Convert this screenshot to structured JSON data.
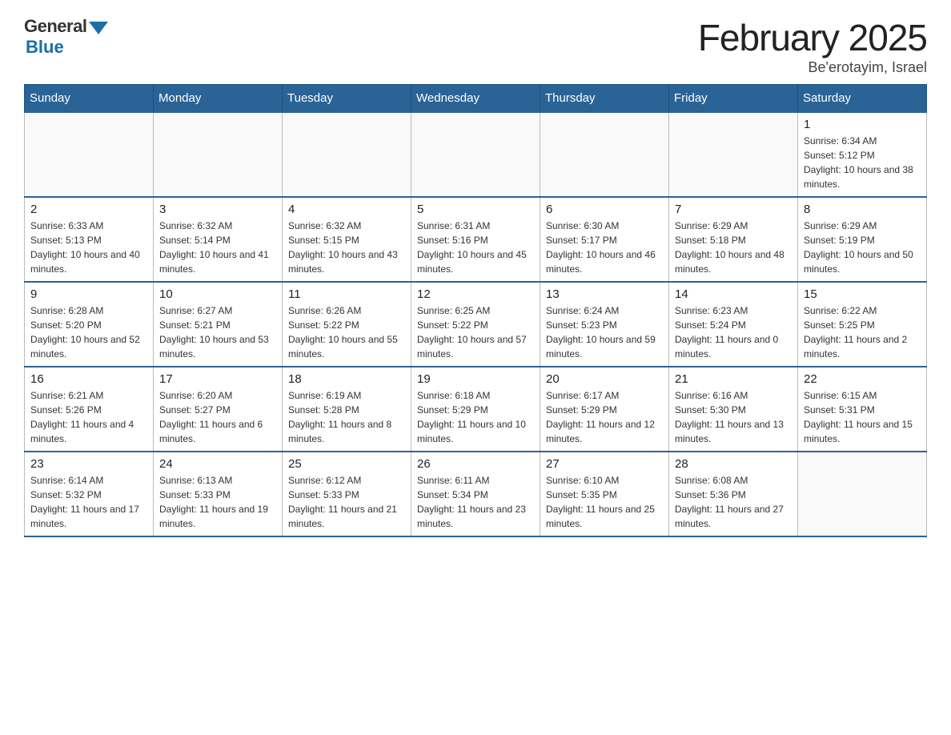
{
  "logo": {
    "general": "General",
    "blue": "Blue"
  },
  "title": "February 2025",
  "subtitle": "Be'erotayim, Israel",
  "days_of_week": [
    "Sunday",
    "Monday",
    "Tuesday",
    "Wednesday",
    "Thursday",
    "Friday",
    "Saturday"
  ],
  "weeks": [
    [
      {
        "day": "",
        "sunrise": "",
        "sunset": "",
        "daylight": ""
      },
      {
        "day": "",
        "sunrise": "",
        "sunset": "",
        "daylight": ""
      },
      {
        "day": "",
        "sunrise": "",
        "sunset": "",
        "daylight": ""
      },
      {
        "day": "",
        "sunrise": "",
        "sunset": "",
        "daylight": ""
      },
      {
        "day": "",
        "sunrise": "",
        "sunset": "",
        "daylight": ""
      },
      {
        "day": "",
        "sunrise": "",
        "sunset": "",
        "daylight": ""
      },
      {
        "day": "1",
        "sunrise": "Sunrise: 6:34 AM",
        "sunset": "Sunset: 5:12 PM",
        "daylight": "Daylight: 10 hours and 38 minutes."
      }
    ],
    [
      {
        "day": "2",
        "sunrise": "Sunrise: 6:33 AM",
        "sunset": "Sunset: 5:13 PM",
        "daylight": "Daylight: 10 hours and 40 minutes."
      },
      {
        "day": "3",
        "sunrise": "Sunrise: 6:32 AM",
        "sunset": "Sunset: 5:14 PM",
        "daylight": "Daylight: 10 hours and 41 minutes."
      },
      {
        "day": "4",
        "sunrise": "Sunrise: 6:32 AM",
        "sunset": "Sunset: 5:15 PM",
        "daylight": "Daylight: 10 hours and 43 minutes."
      },
      {
        "day": "5",
        "sunrise": "Sunrise: 6:31 AM",
        "sunset": "Sunset: 5:16 PM",
        "daylight": "Daylight: 10 hours and 45 minutes."
      },
      {
        "day": "6",
        "sunrise": "Sunrise: 6:30 AM",
        "sunset": "Sunset: 5:17 PM",
        "daylight": "Daylight: 10 hours and 46 minutes."
      },
      {
        "day": "7",
        "sunrise": "Sunrise: 6:29 AM",
        "sunset": "Sunset: 5:18 PM",
        "daylight": "Daylight: 10 hours and 48 minutes."
      },
      {
        "day": "8",
        "sunrise": "Sunrise: 6:29 AM",
        "sunset": "Sunset: 5:19 PM",
        "daylight": "Daylight: 10 hours and 50 minutes."
      }
    ],
    [
      {
        "day": "9",
        "sunrise": "Sunrise: 6:28 AM",
        "sunset": "Sunset: 5:20 PM",
        "daylight": "Daylight: 10 hours and 52 minutes."
      },
      {
        "day": "10",
        "sunrise": "Sunrise: 6:27 AM",
        "sunset": "Sunset: 5:21 PM",
        "daylight": "Daylight: 10 hours and 53 minutes."
      },
      {
        "day": "11",
        "sunrise": "Sunrise: 6:26 AM",
        "sunset": "Sunset: 5:22 PM",
        "daylight": "Daylight: 10 hours and 55 minutes."
      },
      {
        "day": "12",
        "sunrise": "Sunrise: 6:25 AM",
        "sunset": "Sunset: 5:22 PM",
        "daylight": "Daylight: 10 hours and 57 minutes."
      },
      {
        "day": "13",
        "sunrise": "Sunrise: 6:24 AM",
        "sunset": "Sunset: 5:23 PM",
        "daylight": "Daylight: 10 hours and 59 minutes."
      },
      {
        "day": "14",
        "sunrise": "Sunrise: 6:23 AM",
        "sunset": "Sunset: 5:24 PM",
        "daylight": "Daylight: 11 hours and 0 minutes."
      },
      {
        "day": "15",
        "sunrise": "Sunrise: 6:22 AM",
        "sunset": "Sunset: 5:25 PM",
        "daylight": "Daylight: 11 hours and 2 minutes."
      }
    ],
    [
      {
        "day": "16",
        "sunrise": "Sunrise: 6:21 AM",
        "sunset": "Sunset: 5:26 PM",
        "daylight": "Daylight: 11 hours and 4 minutes."
      },
      {
        "day": "17",
        "sunrise": "Sunrise: 6:20 AM",
        "sunset": "Sunset: 5:27 PM",
        "daylight": "Daylight: 11 hours and 6 minutes."
      },
      {
        "day": "18",
        "sunrise": "Sunrise: 6:19 AM",
        "sunset": "Sunset: 5:28 PM",
        "daylight": "Daylight: 11 hours and 8 minutes."
      },
      {
        "day": "19",
        "sunrise": "Sunrise: 6:18 AM",
        "sunset": "Sunset: 5:29 PM",
        "daylight": "Daylight: 11 hours and 10 minutes."
      },
      {
        "day": "20",
        "sunrise": "Sunrise: 6:17 AM",
        "sunset": "Sunset: 5:29 PM",
        "daylight": "Daylight: 11 hours and 12 minutes."
      },
      {
        "day": "21",
        "sunrise": "Sunrise: 6:16 AM",
        "sunset": "Sunset: 5:30 PM",
        "daylight": "Daylight: 11 hours and 13 minutes."
      },
      {
        "day": "22",
        "sunrise": "Sunrise: 6:15 AM",
        "sunset": "Sunset: 5:31 PM",
        "daylight": "Daylight: 11 hours and 15 minutes."
      }
    ],
    [
      {
        "day": "23",
        "sunrise": "Sunrise: 6:14 AM",
        "sunset": "Sunset: 5:32 PM",
        "daylight": "Daylight: 11 hours and 17 minutes."
      },
      {
        "day": "24",
        "sunrise": "Sunrise: 6:13 AM",
        "sunset": "Sunset: 5:33 PM",
        "daylight": "Daylight: 11 hours and 19 minutes."
      },
      {
        "day": "25",
        "sunrise": "Sunrise: 6:12 AM",
        "sunset": "Sunset: 5:33 PM",
        "daylight": "Daylight: 11 hours and 21 minutes."
      },
      {
        "day": "26",
        "sunrise": "Sunrise: 6:11 AM",
        "sunset": "Sunset: 5:34 PM",
        "daylight": "Daylight: 11 hours and 23 minutes."
      },
      {
        "day": "27",
        "sunrise": "Sunrise: 6:10 AM",
        "sunset": "Sunset: 5:35 PM",
        "daylight": "Daylight: 11 hours and 25 minutes."
      },
      {
        "day": "28",
        "sunrise": "Sunrise: 6:08 AM",
        "sunset": "Sunset: 5:36 PM",
        "daylight": "Daylight: 11 hours and 27 minutes."
      },
      {
        "day": "",
        "sunrise": "",
        "sunset": "",
        "daylight": ""
      }
    ]
  ]
}
